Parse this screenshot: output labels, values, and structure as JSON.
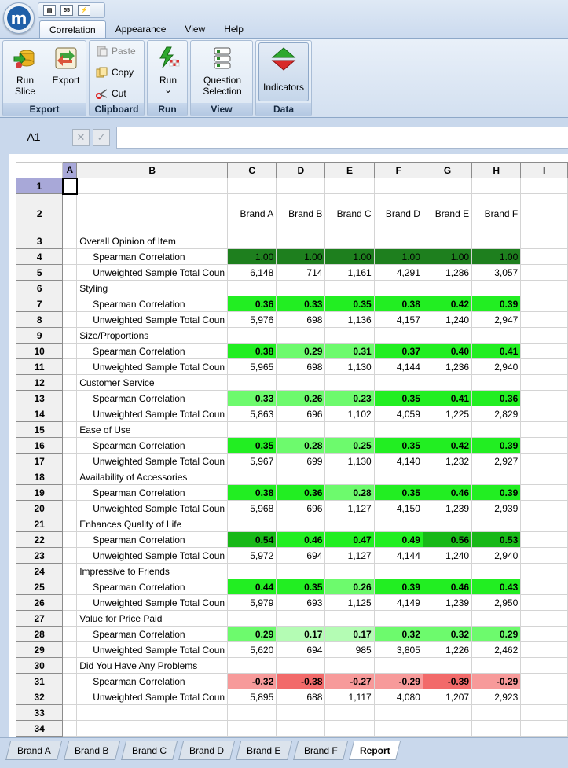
{
  "app": {
    "logo_letter": "m"
  },
  "quick_access": {
    "btn2": "55"
  },
  "menu_tabs": [
    {
      "label": "Correlation",
      "active": true
    },
    {
      "label": "Appearance",
      "active": false
    },
    {
      "label": "View",
      "active": false
    },
    {
      "label": "Help",
      "active": false
    }
  ],
  "ribbon": {
    "export": {
      "label": "Export",
      "run_slice_1": "Run",
      "run_slice_2": "Slice",
      "export_btn": "Export"
    },
    "clipboard": {
      "label": "Clipboard",
      "paste": "Paste",
      "copy": "Copy",
      "cut": "Cut"
    },
    "run": {
      "label": "Run",
      "run_btn": "Run",
      "dropdown": "⌄"
    },
    "view": {
      "label": "View",
      "qs_1": "Question",
      "qs_2": "Selection"
    },
    "data": {
      "label": "Data",
      "indicators": "Indicators"
    }
  },
  "formula_bar": {
    "cell_ref": "A1",
    "cancel": "✕",
    "confirm": "✓",
    "value": ""
  },
  "grid": {
    "col_headers": [
      "A",
      "B",
      "C",
      "D",
      "E",
      "F",
      "G",
      "H",
      "I"
    ],
    "row2": [
      "Brand A",
      "Brand B",
      "Brand C",
      "Brand D",
      "Brand E",
      "Brand F"
    ],
    "rows": [
      {
        "n": "1"
      },
      {
        "n": "2"
      },
      {
        "n": "3",
        "label": "Overall Opinion of Item"
      },
      {
        "n": "4",
        "label": "Spearman Correlation",
        "indent": true,
        "vals": [
          "1.00",
          "1.00",
          "1.00",
          "1.00",
          "1.00",
          "1.00"
        ],
        "colors": [
          "#1e7f1e",
          "#1e7f1e",
          "#1e7f1e",
          "#1e7f1e",
          "#1e7f1e",
          "#1e7f1e"
        ],
        "bold": false
      },
      {
        "n": "5",
        "label": "Unweighted Sample Total Coun",
        "indent": true,
        "vals": [
          "6,148",
          "714",
          "1,161",
          "4,291",
          "1,286",
          "3,057"
        ]
      },
      {
        "n": "6",
        "label": "Styling"
      },
      {
        "n": "7",
        "label": "Spearman Correlation",
        "indent": true,
        "vals": [
          "0.36",
          "0.33",
          "0.35",
          "0.38",
          "0.42",
          "0.39"
        ],
        "colors": [
          "#22ee22",
          "#22ee22",
          "#22ee22",
          "#22ee22",
          "#22ee22",
          "#22ee22"
        ],
        "bold": true
      },
      {
        "n": "8",
        "label": "Unweighted Sample Total Coun",
        "indent": true,
        "vals": [
          "5,976",
          "698",
          "1,136",
          "4,157",
          "1,240",
          "2,947"
        ]
      },
      {
        "n": "9",
        "label": "Size/Proportions"
      },
      {
        "n": "10",
        "label": "Spearman Correlation",
        "indent": true,
        "vals": [
          "0.38",
          "0.29",
          "0.31",
          "0.37",
          "0.40",
          "0.41"
        ],
        "colors": [
          "#22ee22",
          "#6dfa6d",
          "#6dfa6d",
          "#22ee22",
          "#22ee22",
          "#22ee22"
        ],
        "bold": true
      },
      {
        "n": "11",
        "label": "Unweighted Sample Total Coun",
        "indent": true,
        "vals": [
          "5,965",
          "698",
          "1,130",
          "4,144",
          "1,236",
          "2,940"
        ]
      },
      {
        "n": "12",
        "label": "Customer Service"
      },
      {
        "n": "13",
        "label": "Spearman Correlation",
        "indent": true,
        "vals": [
          "0.33",
          "0.26",
          "0.23",
          "0.35",
          "0.41",
          "0.36"
        ],
        "colors": [
          "#6dfa6d",
          "#6dfa6d",
          "#6dfa6d",
          "#22ee22",
          "#22ee22",
          "#22ee22"
        ],
        "bold": true
      },
      {
        "n": "14",
        "label": "Unweighted Sample Total Coun",
        "indent": true,
        "vals": [
          "5,863",
          "696",
          "1,102",
          "4,059",
          "1,225",
          "2,829"
        ]
      },
      {
        "n": "15",
        "label": "Ease of Use"
      },
      {
        "n": "16",
        "label": "Spearman Correlation",
        "indent": true,
        "vals": [
          "0.35",
          "0.28",
          "0.25",
          "0.35",
          "0.42",
          "0.39"
        ],
        "colors": [
          "#22ee22",
          "#6dfa6d",
          "#6dfa6d",
          "#22ee22",
          "#22ee22",
          "#22ee22"
        ],
        "bold": true
      },
      {
        "n": "17",
        "label": "Unweighted Sample Total Coun",
        "indent": true,
        "vals": [
          "5,967",
          "699",
          "1,130",
          "4,140",
          "1,232",
          "2,927"
        ]
      },
      {
        "n": "18",
        "label": "Availability of Accessories"
      },
      {
        "n": "19",
        "label": "Spearman Correlation",
        "indent": true,
        "vals": [
          "0.38",
          "0.36",
          "0.28",
          "0.35",
          "0.46",
          "0.39"
        ],
        "colors": [
          "#22ee22",
          "#22ee22",
          "#6dfa6d",
          "#22ee22",
          "#22ee22",
          "#22ee22"
        ],
        "bold": true
      },
      {
        "n": "20",
        "label": "Unweighted Sample Total Coun",
        "indent": true,
        "vals": [
          "5,968",
          "696",
          "1,127",
          "4,150",
          "1,239",
          "2,939"
        ]
      },
      {
        "n": "21",
        "label": "Enhances Quality of Life"
      },
      {
        "n": "22",
        "label": "Spearman Correlation",
        "indent": true,
        "vals": [
          "0.54",
          "0.46",
          "0.47",
          "0.49",
          "0.56",
          "0.53"
        ],
        "colors": [
          "#18b818",
          "#22ee22",
          "#22ee22",
          "#22ee22",
          "#18b818",
          "#18b818"
        ],
        "bold": true
      },
      {
        "n": "23",
        "label": "Unweighted Sample Total Coun",
        "indent": true,
        "vals": [
          "5,972",
          "694",
          "1,127",
          "4,144",
          "1,240",
          "2,940"
        ]
      },
      {
        "n": "24",
        "label": "Impressive to Friends"
      },
      {
        "n": "25",
        "label": "Spearman Correlation",
        "indent": true,
        "vals": [
          "0.44",
          "0.35",
          "0.26",
          "0.39",
          "0.46",
          "0.43"
        ],
        "colors": [
          "#22ee22",
          "#22ee22",
          "#6dfa6d",
          "#22ee22",
          "#22ee22",
          "#22ee22"
        ],
        "bold": true
      },
      {
        "n": "26",
        "label": "Unweighted Sample Total Coun",
        "indent": true,
        "vals": [
          "5,979",
          "693",
          "1,125",
          "4,149",
          "1,239",
          "2,950"
        ]
      },
      {
        "n": "27",
        "label": "Value for Price Paid"
      },
      {
        "n": "28",
        "label": "Spearman Correlation",
        "indent": true,
        "vals": [
          "0.29",
          "0.17",
          "0.17",
          "0.32",
          "0.32",
          "0.29"
        ],
        "colors": [
          "#6dfa6d",
          "#b4fcb4",
          "#b4fcb4",
          "#6dfa6d",
          "#6dfa6d",
          "#6dfa6d"
        ],
        "bold": true
      },
      {
        "n": "29",
        "label": "Unweighted Sample Total Coun",
        "indent": true,
        "vals": [
          "5,620",
          "694",
          "985",
          "3,805",
          "1,226",
          "2,462"
        ]
      },
      {
        "n": "30",
        "label": "Did You Have Any Problems"
      },
      {
        "n": "31",
        "label": "Spearman Correlation",
        "indent": true,
        "vals": [
          "-0.32",
          "-0.38",
          "-0.27",
          "-0.29",
          "-0.39",
          "-0.29"
        ],
        "colors": [
          "#f79a9a",
          "#f26a6a",
          "#f79a9a",
          "#f79a9a",
          "#f26a6a",
          "#f79a9a"
        ],
        "bold": true
      },
      {
        "n": "32",
        "label": "Unweighted Sample Total Coun",
        "indent": true,
        "vals": [
          "5,895",
          "688",
          "1,117",
          "4,080",
          "1,207",
          "2,923"
        ]
      },
      {
        "n": "33"
      },
      {
        "n": "34"
      }
    ]
  },
  "sheet_tabs": [
    {
      "label": "Brand A",
      "active": false
    },
    {
      "label": "Brand B",
      "active": false
    },
    {
      "label": "Brand C",
      "active": false
    },
    {
      "label": "Brand D",
      "active": false
    },
    {
      "label": "Brand E",
      "active": false
    },
    {
      "label": "Brand F",
      "active": false
    },
    {
      "label": "Report",
      "active": true
    }
  ]
}
